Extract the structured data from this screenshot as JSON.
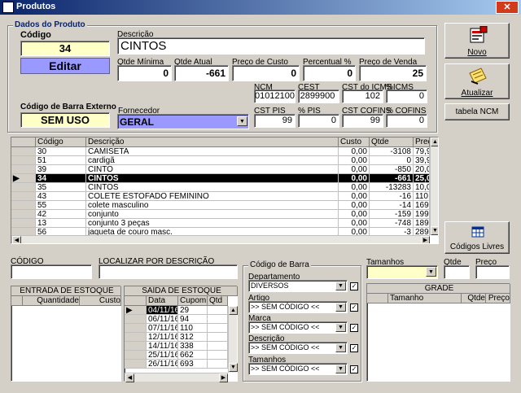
{
  "window": {
    "title": "Produtos",
    "close": "✕"
  },
  "product": {
    "group_title": "Dados do Produto",
    "code_label": "Código",
    "code": "34",
    "mode": "Editar",
    "desc_label": "Descrição",
    "desc": "CINTOS",
    "qmin_label": "Qtde Mínima",
    "qmin": "0",
    "qatual_label": "Qtde Atual",
    "qatual": "-661",
    "custo_label": "Preço de Custo",
    "custo": "0",
    "perc_label": "Percentual %",
    "perc": "0",
    "venda_label": "Preço de Venda",
    "venda": "25",
    "barcode_label": "Código de Barra Externo",
    "barcode": "SEM USO",
    "forn_label": "Fornecedor",
    "forn": "GERAL",
    "ncm_label": "NCM",
    "ncm": "01012100",
    "cest_label": "CEST",
    "cest": "2899900",
    "cst_icms_label": "CST do ICMS",
    "cst_icms": "102",
    "icms_label": "%ICMS",
    "icms": "0",
    "cst_pis_label": "CST PIS",
    "cst_pis": "99",
    "pis_label": "% PIS",
    "pis": "0",
    "cst_cofins_label": "CST COFINS",
    "cst_cofins": "99",
    "cofins_label": "% COFINS",
    "cofins": "0"
  },
  "buttons": {
    "novo": "Novo",
    "atualizar": "Atualizar",
    "ncm": "tabela NCM",
    "livres": "Códigos Livres"
  },
  "table": {
    "headers": [
      "Código",
      "Descrição",
      "Custo",
      "Qtde",
      "Preç"
    ],
    "rows": [
      [
        "30",
        "CAMISETA",
        "0,00",
        "-3108",
        "79,9"
      ],
      [
        "51",
        "cardigã",
        "0,00",
        "0",
        "39,9"
      ],
      [
        "39",
        "CINTO",
        "0,00",
        "-850",
        "20,0"
      ],
      [
        "34",
        "CINTOS",
        "0,00",
        "-661",
        "25,0"
      ],
      [
        "35",
        "CINTOS",
        "0,00",
        "-13283",
        "10,0"
      ],
      [
        "43",
        "COLETE ESTOFADO FEMININO",
        "0,00",
        "-16",
        "110,0"
      ],
      [
        "55",
        "colete masculino",
        "0,00",
        "-14",
        "169,9"
      ],
      [
        "42",
        "conjunto",
        "0,00",
        "-159",
        "199,9"
      ],
      [
        "13",
        "conjunto 3 peças",
        "0,00",
        "-748",
        "189,9"
      ],
      [
        "56",
        "jaqueta de couro masc.",
        "0,00",
        "-3",
        "289,9"
      ]
    ],
    "selected_index": 3
  },
  "search": {
    "code_label": "CÓDIGO",
    "desc_label": "LOCALIZAR POR DESCRIÇÃO"
  },
  "entrada": {
    "title": "ENTRADA DE ESTOQUE",
    "col1": "Quantidade",
    "col2": "Custo"
  },
  "saida": {
    "title": "SAÍDA DE ESTOQUE",
    "headers": [
      "Data",
      "Cupom",
      "Qtd"
    ],
    "rows": [
      [
        "04/11/16",
        "29"
      ],
      [
        "06/11/16",
        "94"
      ],
      [
        "07/11/16",
        "110"
      ],
      [
        "12/11/16",
        "312"
      ],
      [
        "14/11/16",
        "338"
      ],
      [
        "25/11/16",
        "662"
      ],
      [
        "26/11/16",
        "693"
      ]
    ]
  },
  "barra": {
    "title": "Código de Barra",
    "dept_label": "Departamento",
    "dept": "DIVERSOS",
    "artigo_label": "Artigo",
    "artigo": ">> SEM CÓDIGO <<",
    "marca_label": "Marca",
    "marca": ">> SEM CÓDIGO <<",
    "descr_label": "Descrição",
    "descr": ">> SEM CÓDIGO <<",
    "tam_label": "Tamanhos",
    "tam": ">> SEM CÓDIGO <<"
  },
  "tamanhos": {
    "label": "Tamanhos",
    "qtde_label": "Qtde",
    "preco_label": "Preço"
  },
  "grade": {
    "title": "GRADE",
    "headers": [
      "Tamanho",
      "Qtde",
      "Preço"
    ]
  }
}
